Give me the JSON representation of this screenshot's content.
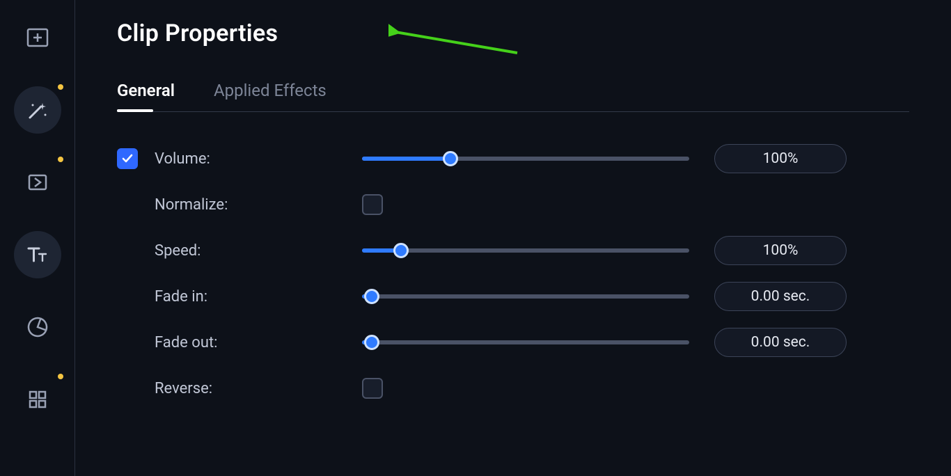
{
  "sidebar": {
    "items": [
      {
        "name": "import",
        "dot": false,
        "active": false
      },
      {
        "name": "effects",
        "dot": true,
        "active": true
      },
      {
        "name": "transitions",
        "dot": true,
        "active": false
      },
      {
        "name": "titles",
        "dot": false,
        "active": true
      },
      {
        "name": "stickers",
        "dot": false,
        "active": false
      },
      {
        "name": "more",
        "dot": true,
        "active": false
      }
    ]
  },
  "header": {
    "title": "Clip Properties"
  },
  "tabs": [
    {
      "label": "General",
      "active": true
    },
    {
      "label": "Applied Effects",
      "active": false
    }
  ],
  "properties": {
    "volume": {
      "label": "Volume:",
      "checked": true,
      "fill_percent": 27,
      "value": "100%"
    },
    "normalize": {
      "label": "Normalize:",
      "checked": false
    },
    "speed": {
      "label": "Speed:",
      "fill_percent": 12,
      "value": "100%"
    },
    "fade_in": {
      "label": "Fade in:",
      "fill_percent": 3,
      "value": "0.00 sec."
    },
    "fade_out": {
      "label": "Fade out:",
      "fill_percent": 3,
      "value": "0.00 sec."
    },
    "reverse": {
      "label": "Reverse:",
      "checked": false
    }
  },
  "colors": {
    "accent": "#2f7bff",
    "annotation": "#45d11a"
  }
}
